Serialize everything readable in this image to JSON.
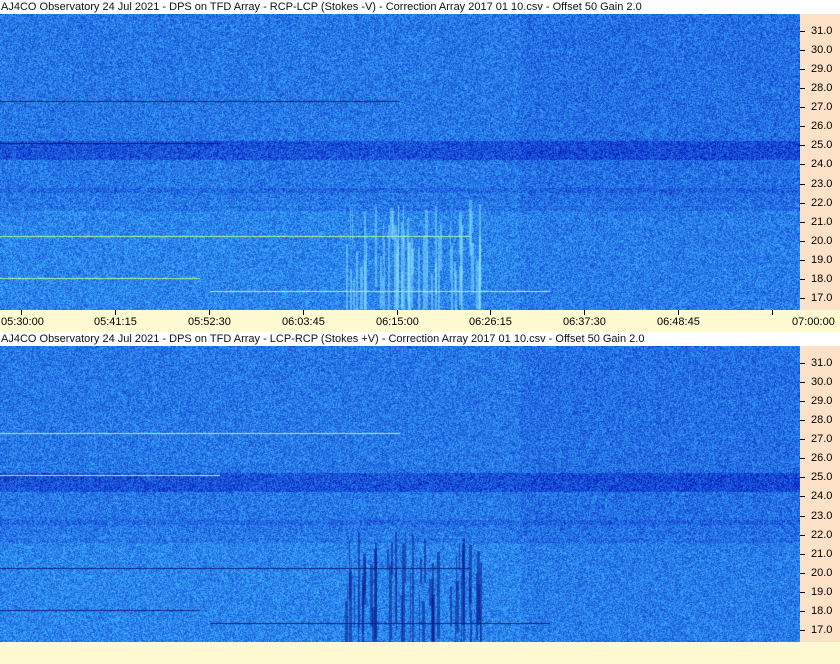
{
  "panels": {
    "top_title": "AJ4CO Observatory 24 Jul 2021  -  DPS on TFD Array  -  RCP-LCP (Stokes -V)  -  Correction Array 2017 01 10.csv  -  Offset 50  Gain 2.0",
    "bottom_title": "AJ4CO Observatory 24 Jul 2021  -  DPS on TFD Array  -  LCP-RCP (Stokes +V)  -  Correction Array 2017 01 10.csv  -  Offset 50  Gain 2.0"
  },
  "frequency_ticks": [
    "31.0",
    "30.0",
    "29.0",
    "28.0",
    "27.0",
    "26.0",
    "25.0",
    "24.0",
    "23.0",
    "22.0",
    "21.0",
    "20.0",
    "19.0",
    "18.0",
    "17.0"
  ],
  "time_ticks": [
    "05:30:00",
    "05:41:15",
    "05:52:30",
    "06:03:45",
    "06:15:00",
    "06:26:15",
    "06:37:30",
    "06:48:45",
    "07:00:00"
  ],
  "colors": {
    "spectrogram_base": "#1f56e0",
    "frequency_axis_bg": "#fde2c8",
    "time_axis_bg": "#fffad2"
  }
}
